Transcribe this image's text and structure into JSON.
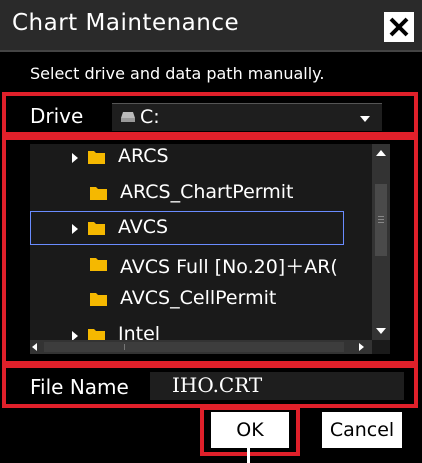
{
  "window": {
    "title": "Chart Maintenance",
    "close_icon": "close-icon"
  },
  "instruction": "Select drive and data path manually.",
  "drive": {
    "label": "Drive",
    "icon": "drive-icon",
    "value": "C:"
  },
  "folders": [
    {
      "label": "ARCS",
      "expandable": true,
      "selected": false
    },
    {
      "label": "ARCS_ChartPermit",
      "expandable": false,
      "selected": false
    },
    {
      "label": "AVCS",
      "expandable": true,
      "selected": true
    },
    {
      "label": "AVCS Full [No.20]＋AR(",
      "expandable": false,
      "selected": false
    },
    {
      "label": "AVCS_CellPermit",
      "expandable": false,
      "selected": false
    },
    {
      "label": "Intel",
      "expandable": true,
      "selected": false
    }
  ],
  "file_name": {
    "label": "File Name",
    "value": "IHO.CRT"
  },
  "buttons": {
    "ok": "OK",
    "cancel": "Cancel"
  },
  "colors": {
    "highlight": "#e0202a",
    "folder": "#f5b800",
    "selection": "#6a8cff",
    "background": "#000000"
  }
}
